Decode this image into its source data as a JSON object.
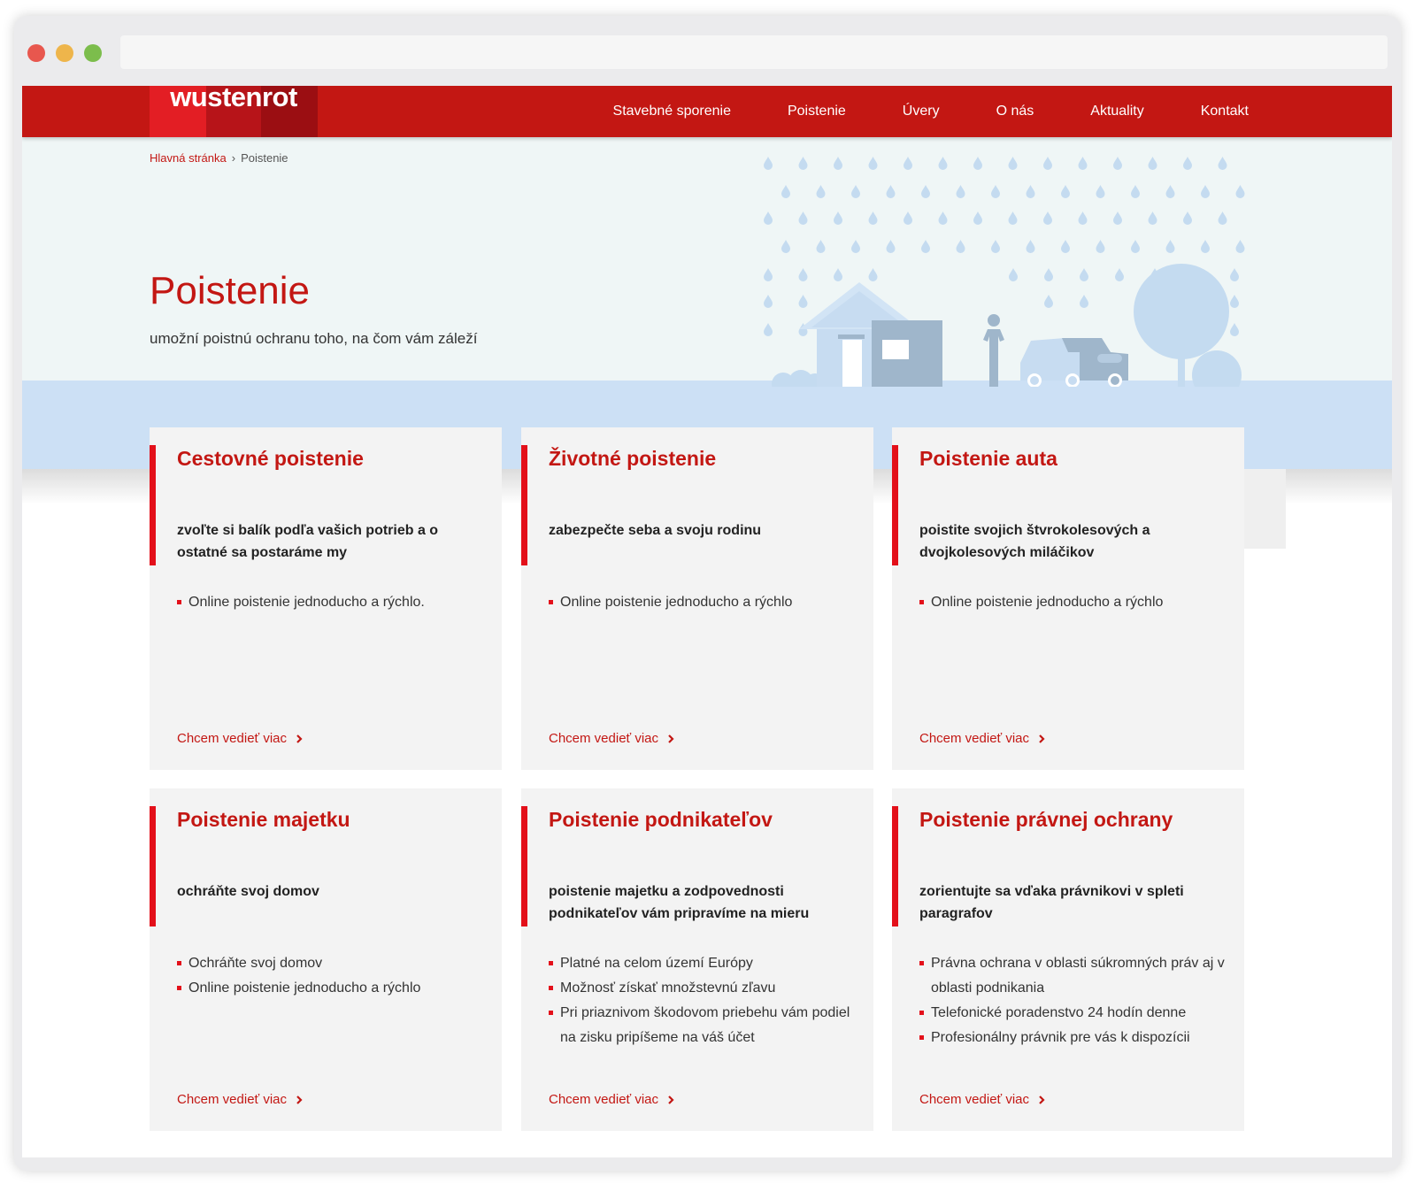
{
  "header": {
    "logo_text": "wustenrot",
    "nav": [
      {
        "label": "Stavebné sporenie"
      },
      {
        "label": "Poistenie"
      },
      {
        "label": "Úvery"
      },
      {
        "label": "O nás"
      },
      {
        "label": "Aktuality"
      },
      {
        "label": "Kontakt"
      }
    ]
  },
  "breadcrumb": {
    "home": "Hlavná stránka",
    "current": "Poistenie"
  },
  "hero": {
    "title": "Poistenie",
    "subtitle": "umožní poistnú ochranu toho, na čom vám záleží"
  },
  "colors": {
    "brand_red": "#c31713",
    "accent_red": "#e3101a",
    "hero_bg": "#eff6f6",
    "band_blue": "#cce0f5",
    "card_bg": "#f3f3f3"
  },
  "cards": [
    {
      "title": "Cestovné poistenie",
      "desc": "zvoľte si balík podľa vašich potrieb a o ostatné sa postaráme my",
      "bullets": [
        "Online poistenie jednoducho a rýchlo."
      ],
      "link": "Chcem vedieť viac"
    },
    {
      "title": "Životné poistenie",
      "desc": "zabezpečte seba a svoju rodinu",
      "bullets": [
        "Online poistenie jednoducho a rýchlo"
      ],
      "link": "Chcem vedieť viac"
    },
    {
      "title": "Poistenie auta",
      "desc": "poistite svojich štvrokolesových a dvojkolesových miláčikov",
      "bullets": [
        "Online poistenie jednoducho a rýchlo"
      ],
      "link": "Chcem vedieť viac"
    },
    {
      "title": "Poistenie majetku",
      "desc": "ochráňte svoj domov",
      "bullets": [
        "Ochráňte svoj domov",
        "Online poistenie jednoducho a rýchlo"
      ],
      "link": "Chcem vedieť viac"
    },
    {
      "title": "Poistenie podnikateľov",
      "desc": "poistenie majetku a zodpovednosti podnikateľov vám pripravíme na mieru",
      "bullets": [
        "Platné na celom území Európy",
        "Možnosť získať množstevnú zľavu",
        "Pri priaznivom škodovom priebehu vám podiel na zisku pripíšeme na váš účet"
      ],
      "link": "Chcem vedieť viac"
    },
    {
      "title": "Poistenie právnej ochrany",
      "desc": "zorientujte sa vďaka právnikovi v spleti paragrafov",
      "bullets": [
        "Právna ochrana v oblasti súkromných práv aj v oblasti podnikania",
        "Telefonické poradenstvo 24 hodín denne",
        "Profesionálny právnik pre vás k dispozícii"
      ],
      "link": "Chcem vedieť viac"
    }
  ]
}
